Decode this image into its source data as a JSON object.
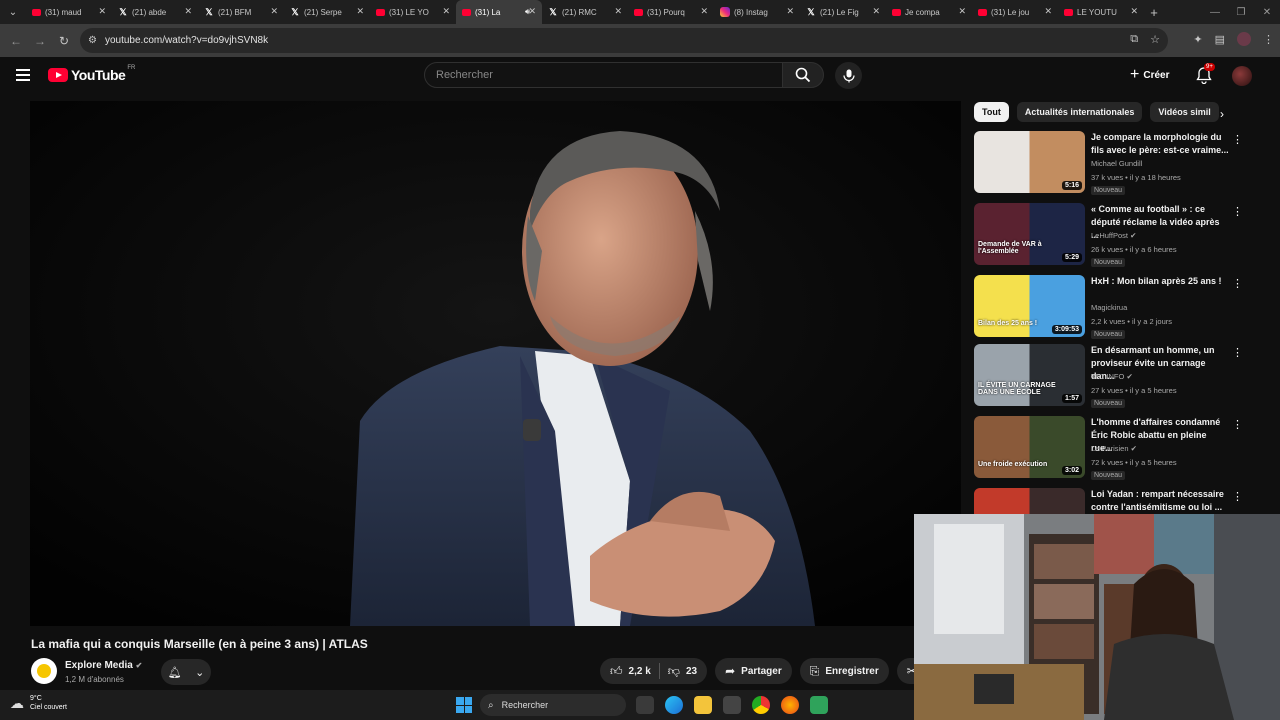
{
  "browser": {
    "tabs": [
      {
        "label": "(31) maud",
        "icon": "youtube-icon",
        "active": false
      },
      {
        "label": "(21) abde",
        "icon": "x-icon",
        "active": false
      },
      {
        "label": "(21) BFM",
        "icon": "x-icon",
        "active": false
      },
      {
        "label": "(21) Serpe",
        "icon": "x-icon",
        "active": false
      },
      {
        "label": "(31) LE YO",
        "icon": "youtube-icon",
        "active": false
      },
      {
        "label": "(31) La",
        "icon": "youtube-icon",
        "active": true
      },
      {
        "label": "(21) RMC",
        "icon": "x-icon",
        "active": false
      },
      {
        "label": "(31) Pourq",
        "icon": "youtube-icon",
        "active": false
      },
      {
        "label": "(8) Instag",
        "icon": "instagram-icon",
        "active": false
      },
      {
        "label": "(21) Le Fig",
        "icon": "x-icon",
        "active": false
      },
      {
        "label": "Je compa",
        "icon": "youtube-icon",
        "active": false
      },
      {
        "label": "(31) Le jou",
        "icon": "youtube-icon",
        "active": false
      },
      {
        "label": "LE YOUTU",
        "icon": "youtube-icon",
        "active": false
      }
    ],
    "url": "youtube.com/watch?v=do9vjhSVN8k"
  },
  "header": {
    "logo_text": "YouTube",
    "country_code": "FR",
    "search_placeholder": "Rechercher",
    "create_label": "Créer",
    "notification_count": "9+"
  },
  "video": {
    "title": "La mafia qui a conquis Marseille (en à peine 3 ans) | ATLAS",
    "channel": "Explore Media",
    "subscribers": "1,2 M d'abonnés",
    "likes": "2,2 k",
    "dislikes": "23",
    "share_label": "Partager",
    "save_label": "Enregistrer",
    "clip_label": "Cl"
  },
  "sidebar": {
    "chips": [
      "Tout",
      "Actualités internationales",
      "Vidéos simil"
    ],
    "recommendations": [
      {
        "title": "Je compare la morphologie du fils avec le père: est-ce vraime...",
        "channel": "Michael Gundill",
        "meta": "37 k vues • il y a 18 heures",
        "badge": "Nouveau",
        "duration": "5:16",
        "verified": false,
        "thumb_colors": [
          "#e8e4e0",
          "#c28d60"
        ]
      },
      {
        "title": "« Comme au football » : ce député réclame la vidéo après ...",
        "channel": "LeHuffPost",
        "meta": "26 k vues • il y a 6 heures",
        "badge": "Nouveau",
        "duration": "5:29",
        "verified": true,
        "thumb_colors": [
          "#5a2230",
          "#1d2545"
        ],
        "thumb_text": "Demande de VAR à l'Assemblée"
      },
      {
        "title": "HxH : Mon bilan après 25 ans !",
        "channel": "Magickirua",
        "meta": "2,2 k vues • il y a 2 jours",
        "badge": "Nouveau",
        "duration": "3:09:53",
        "verified": false,
        "thumb_colors": [
          "#f4e04d",
          "#4aa0e0"
        ],
        "thumb_text": "Bilan des 25 ans !"
      },
      {
        "title": "En désarmant un homme, un proviseur évite un carnage dan...",
        "channel": "TF1 INFO",
        "meta": "27 k vues • il y a 5 heures",
        "badge": "Nouveau",
        "duration": "1:57",
        "verified": true,
        "thumb_colors": [
          "#9aa3ab",
          "#2a2e33"
        ],
        "thumb_text": "IL ÉVITE UN CARNAGE DANS UNE ÉCOLE"
      },
      {
        "title": "L'homme d'affaires condamné Éric Robic abattu en pleine rue...",
        "channel": "Le Parisien",
        "meta": "72 k vues • il y a 5 heures",
        "badge": "Nouveau",
        "duration": "3:02",
        "verified": true,
        "thumb_colors": [
          "#8a5a3a",
          "#3a4a2a"
        ],
        "thumb_text": "Une froide exécution"
      },
      {
        "title": "Loi Yadan : rempart nécessaire contre l'antisémitisme ou loi ...",
        "channel": "",
        "meta": "",
        "badge": "",
        "duration": "",
        "verified": false,
        "thumb_colors": [
          "#c23a2a",
          "#3a2a2a"
        ]
      }
    ]
  },
  "taskbar": {
    "temperature": "9°C",
    "weather": "Ciel couvert",
    "search_label": "Rechercher"
  }
}
